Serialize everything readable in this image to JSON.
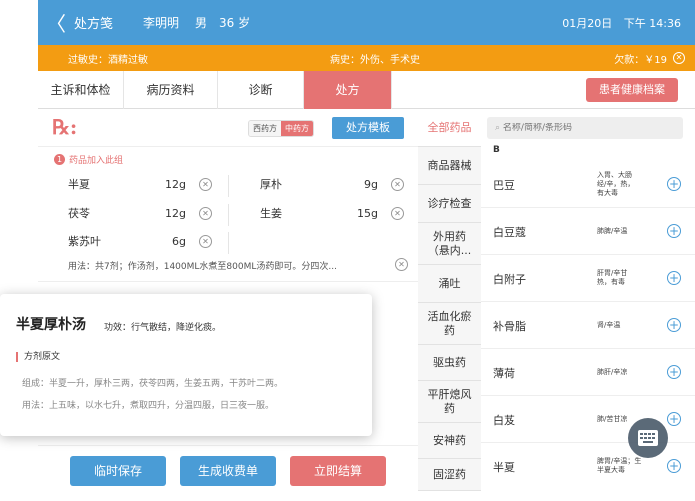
{
  "header": {
    "back_glyph": "〈",
    "title": "处方笺",
    "patient_name": "李明明",
    "gender": "男",
    "age": "36 岁",
    "date": "01月20日",
    "time": "下午 14:36"
  },
  "alert_bar": {
    "allergy": "过敏史：酒精过敏",
    "history": "病史：外伤、手术史",
    "arrears": "欠款：￥19"
  },
  "tabs": [
    {
      "label": "主诉和体检"
    },
    {
      "label": "病历资料"
    },
    {
      "label": "诊断"
    },
    {
      "label": "处方"
    }
  ],
  "archive_button": "患者健康档案",
  "rx": {
    "mark": "℞:",
    "seg_western": "西药方",
    "seg_chinese": "中药方",
    "template_button": "处方模板",
    "group_number": "1",
    "group_label": "药品加入此组",
    "herbs": [
      {
        "name": "半夏",
        "dose": "12g"
      },
      {
        "name": "厚朴",
        "dose": "9g"
      },
      {
        "name": "茯苓",
        "dose": "12g"
      },
      {
        "name": "生姜",
        "dose": "15g"
      },
      {
        "name": "紫苏叶",
        "dose": "6g"
      }
    ],
    "usage": "用法：共7剂；作汤剂，1400ML水煮至800ML汤药即可。分四次..."
  },
  "bottom_buttons": {
    "save": "临时保存",
    "bill": "生成收费单",
    "checkout": "立即结算"
  },
  "categories": [
    {
      "label": "全部药品"
    },
    {
      "label": "商品器械"
    },
    {
      "label": "诊疗检查"
    },
    {
      "label": "外用药\n（悬内..."
    },
    {
      "label": "涌吐"
    },
    {
      "label": "活血化瘀\n药"
    },
    {
      "label": "驱虫药"
    },
    {
      "label": "平肝熄风\n药"
    },
    {
      "label": "安神药"
    },
    {
      "label": "固涩药"
    }
  ],
  "search": {
    "placeholder": "名称/简称/条形码"
  },
  "letter": "B",
  "drugs": [
    {
      "name": "巴豆",
      "desc": "入胃、大肠\n经/辛，热，\n有大毒"
    },
    {
      "name": "白豆蔻",
      "desc": "肺脾/辛温"
    },
    {
      "name": "白附子",
      "desc": "肝胃/辛甘\n热，有毒"
    },
    {
      "name": "补骨脂",
      "desc": "肾/辛温"
    },
    {
      "name": "薄荷",
      "desc": "肺肝/辛凉"
    },
    {
      "name": "白芨",
      "desc": "肺/苦甘凉"
    },
    {
      "name": "半夏",
      "desc": "脾胃/辛温；生\n半夏大毒"
    }
  ],
  "popup": {
    "title": "半夏厚朴汤",
    "effect": "功效：行气散结，降逆化痰。",
    "section": "方剂原文",
    "composition": "组成：半夏一升，厚朴三两，茯苓四两，生姜五两，干苏叶二两。",
    "method": "用法：上五味，以水七升，煮取四升，分温四服，日三夜一服。"
  },
  "colors": {
    "header_blue": "#4a9cd6",
    "alert_orange": "#f39c12",
    "accent_red": "#e57373"
  }
}
